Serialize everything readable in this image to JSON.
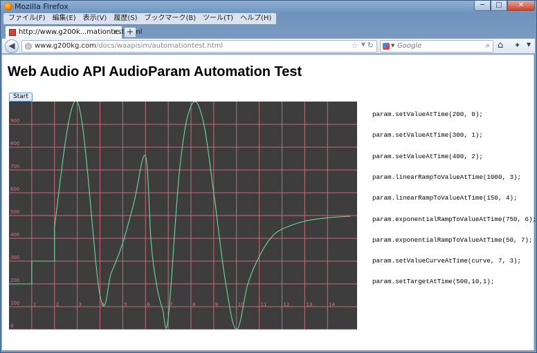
{
  "window": {
    "title": "Mozilla Firefox",
    "minimize": "─",
    "maximize": "□",
    "close": "✕"
  },
  "menu": [
    "ファイル(F)",
    "編集(E)",
    "表示(V)",
    "履歴(S)",
    "ブックマーク(B)",
    "ツール(T)",
    "ヘルプ(H)"
  ],
  "tab": {
    "label": "http://www.g200k...mationtest.html",
    "close": "×",
    "new": "+"
  },
  "nav": {
    "url_host": "www.g200kg.com",
    "url_path": "/docs/waapisim/automationtest.html",
    "search_placeholder": "Google"
  },
  "page": {
    "title": "Web Audio API AudioParam Automation Test",
    "start_label": "Start",
    "code_lines": [
      "param.setValueAtTime(200, 0);",
      "param.setValueAtTime(300, 1);",
      "param.setValueAtTime(400, 2);",
      "param.linearRampToValueAtTime(1000, 3);",
      "param.linearRampToValueAtTime(150, 4);",
      "param.exponentialRampToValueAtTime(750, 6);",
      "param.exponentialRampToValueAtTime(50, 7);",
      "param.setValueCurveAtTime(curve, 7, 3);",
      "param.setTargetAtTime(500,10,1);"
    ]
  },
  "chart_data": {
    "type": "line",
    "xlabel": "",
    "ylabel": "",
    "xlim": [
      0,
      15.3
    ],
    "ylim": [
      0,
      1000
    ],
    "x_ticks": [
      "1",
      "2",
      "3",
      "4",
      "5",
      "6",
      "7",
      "8",
      "9",
      "10",
      "11",
      "12",
      "13",
      "14"
    ],
    "y_ticks": [
      "0",
      "100",
      "200",
      "300",
      "400",
      "500",
      "600",
      "700",
      "800",
      "900"
    ],
    "grid": true,
    "colors": {
      "background": "#3d3d3d",
      "grid": "#c96b7a",
      "line": "#6fd8a0",
      "tick_label": "#d17a86"
    },
    "series": [
      {
        "x": [
          0,
          1,
          1,
          2,
          2,
          3,
          4,
          4.5,
          5,
          5.5,
          6,
          6.25,
          6.5,
          6.75,
          7,
          7.5,
          8,
          8.5,
          9,
          9.5,
          10,
          10.5,
          11,
          11.5,
          12,
          13,
          14,
          15
        ],
        "y": [
          200,
          200,
          300,
          300,
          450,
          1000,
          150,
          250,
          380,
          560,
          760,
          380,
          190,
          90,
          50,
          700,
          980,
          930,
          600,
          220,
          0,
          200,
          320,
          400,
          440,
          475,
          490,
          497
        ]
      }
    ]
  }
}
